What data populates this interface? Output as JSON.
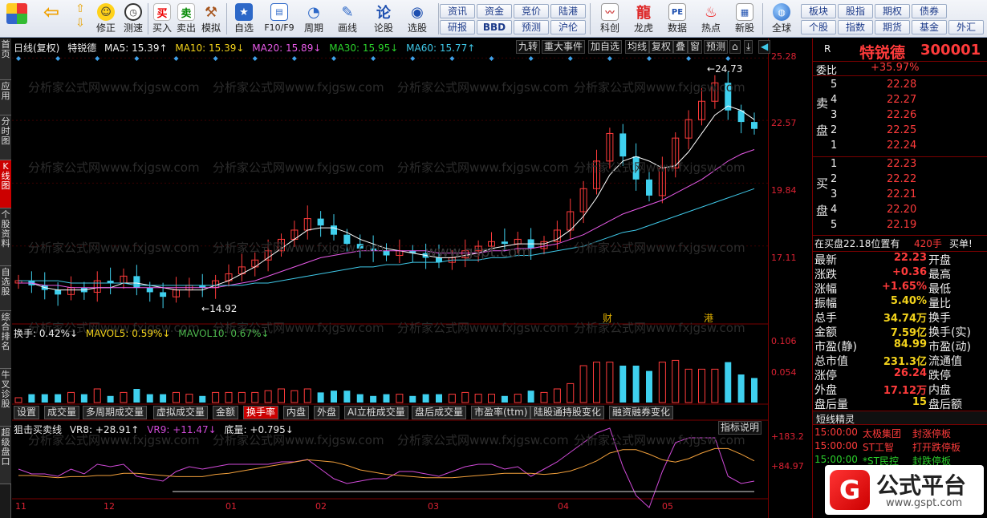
{
  "toolbar": {
    "buttons": [
      {
        "label": "",
        "icon": "apps-grid-icon"
      },
      {
        "label": "",
        "icon": "back-arrow-icon"
      },
      {
        "label": "",
        "icon": "up-down-arrows-icon"
      },
      {
        "label": "修正",
        "icon": "smile-icon"
      },
      {
        "label": "测速",
        "icon": "clock-icon"
      },
      {
        "label": "买入",
        "icon": "buy-icon",
        "glyph": "买"
      },
      {
        "label": "卖出",
        "icon": "sell-icon",
        "glyph": "卖"
      },
      {
        "label": "模拟",
        "icon": "hammer-icon"
      },
      {
        "label": "自选",
        "icon": "star-icon"
      },
      {
        "label": "F10/F9",
        "icon": "f10-icon"
      },
      {
        "label": "周期",
        "icon": "cycle-icon"
      },
      {
        "label": "画线",
        "icon": "pencil-icon"
      },
      {
        "label": "论股",
        "icon": "talk-icon",
        "glyph": "论"
      },
      {
        "label": "选股",
        "icon": "select-stock-icon"
      },
      {
        "label": "科创",
        "icon": "kechuang-icon"
      },
      {
        "label": "龙虎",
        "icon": "dragon-tiger-icon"
      },
      {
        "label": "数据",
        "icon": "pe-data-icon",
        "glyph": "PE"
      },
      {
        "label": "热点",
        "icon": "hot-flame-icon"
      },
      {
        "label": "新股",
        "icon": "new-stock-icon"
      },
      {
        "label": "全球",
        "icon": "globe-icon"
      }
    ],
    "grid1": [
      "资讯",
      "资金",
      "竞价",
      "陆港",
      "研报",
      "BBD",
      "预测",
      "沪伦"
    ],
    "grid2": [
      "板块",
      "股指",
      "期权",
      "债券",
      "个股",
      "指数",
      "期货",
      "基金",
      "外汇"
    ]
  },
  "lefttabs": [
    "首页",
    "应用",
    "分时图",
    "K线图",
    "个股资料",
    "自选股",
    "综合排名",
    "牛叉诊股",
    "超级盘口"
  ],
  "chart": {
    "header": {
      "period": "日线(复权)",
      "name": "特锐德",
      "ma5": "MA5: 15.39↑",
      "ma10": "MA10: 15.39↓",
      "ma20": "MA20: 15.89↓",
      "ma30": "MA30: 15.95↓",
      "ma60": "MA60: 15.77↑"
    },
    "buttons": [
      "九转",
      "重大事件",
      "加自选",
      "均线",
      "复权",
      "叠",
      "窗",
      "预测"
    ],
    "watermark": "分析家公式网www.fxjgsw.com",
    "site_watermark": "www.gspt.com",
    "price_ticks": [
      "25.28",
      "22.57",
      "19.84",
      "17.11"
    ],
    "high_label": "24.73",
    "low_label": "14.92",
    "event_markers": [
      "财",
      "港"
    ],
    "vol_header": {
      "hs": "换手: 0.42%↓",
      "mavol5": "MAVOL5: 0.59%↓",
      "mavol10": "MAVOL10: 0.67%↓"
    },
    "vol_ticks": [
      "0.106",
      "0.054"
    ],
    "subtabs": [
      "设置",
      "成交量",
      "多周期成交量",
      "虚拟成交量",
      "金额",
      "换手率",
      "内盘",
      "外盘",
      "AI立桩成交量",
      "盘后成交量",
      "市盈率(ttm)",
      "陆股通持股变化",
      "融资融券变化"
    ],
    "active_subtab": "换手率",
    "ind_header": {
      "name": "狙击买卖线",
      "vr8": "VR8: +28.91↑",
      "vr9": "VR9: +11.47↓",
      "floor": "底量: +0.795↓"
    },
    "ind_button": "指标说明",
    "ind_ticks": [
      "+183.2",
      "+84.97"
    ],
    "xlabels": [
      "11",
      "12",
      "01",
      "02",
      "03",
      "04",
      "05"
    ]
  },
  "chart_data": {
    "type": "line",
    "title": "特锐德 日线(复权)",
    "ylim": [
      14.0,
      25.5
    ],
    "x": [
      "11",
      "12",
      "01",
      "02",
      "03",
      "04",
      "05"
    ],
    "series": [
      {
        "name": "Close",
        "values": [
          15.6,
          15.4,
          15.2,
          15.0,
          15.3,
          15.1,
          15.6,
          15.5,
          15.8,
          15.3,
          15.1,
          14.9,
          15.2,
          15.4,
          15.3,
          15.6,
          15.9,
          16.2,
          16.5,
          16.9,
          17.4,
          17.8,
          18.3,
          18.0,
          17.6,
          17.2,
          17.0,
          16.9,
          16.7,
          16.9,
          16.8,
          16.6,
          16.4,
          16.6,
          16.9,
          17.1,
          17.3,
          17.2,
          17.4,
          17.0,
          17.3,
          17.8,
          18.6,
          19.6,
          20.8,
          22.0,
          21.0,
          20.0,
          19.3,
          20.5,
          21.8,
          22.6,
          23.4,
          24.2,
          23.0,
          22.5,
          22.2
        ]
      },
      {
        "name": "MA5",
        "values": [
          15.5,
          15.5,
          15.3,
          15.2,
          15.2,
          15.2,
          15.3,
          15.3,
          15.5,
          15.5,
          15.4,
          15.3,
          15.2,
          15.2,
          15.2,
          15.4,
          15.6,
          15.9,
          16.2,
          16.6,
          17.0,
          17.4,
          17.8,
          17.9,
          17.9,
          17.7,
          17.4,
          17.2,
          17.0,
          16.9,
          16.8,
          16.7,
          16.6,
          16.6,
          16.7,
          16.8,
          17.0,
          17.1,
          17.2,
          17.2,
          17.2,
          17.4,
          17.8,
          18.4,
          19.2,
          20.2,
          20.8,
          21.0,
          20.8,
          20.5,
          20.6,
          21.2,
          22.0,
          22.8,
          23.2,
          23.0,
          22.6
        ]
      },
      {
        "name": "MA20",
        "values": [
          15.5,
          15.5,
          15.4,
          15.4,
          15.3,
          15.3,
          15.3,
          15.3,
          15.3,
          15.3,
          15.3,
          15.3,
          15.3,
          15.3,
          15.3,
          15.3,
          15.4,
          15.5,
          15.6,
          15.8,
          16.0,
          16.2,
          16.4,
          16.6,
          16.7,
          16.8,
          16.9,
          16.9,
          16.9,
          16.9,
          16.9,
          16.9,
          16.8,
          16.8,
          16.8,
          16.8,
          16.9,
          16.9,
          17.0,
          17.0,
          17.1,
          17.2,
          17.4,
          17.6,
          17.9,
          18.2,
          18.5,
          18.7,
          18.9,
          19.1,
          19.4,
          19.7,
          20.0,
          20.4,
          20.8,
          21.1,
          21.3
        ]
      },
      {
        "name": "MA60",
        "values": [
          15.6,
          15.6,
          15.6,
          15.6,
          15.5,
          15.5,
          15.5,
          15.5,
          15.5,
          15.4,
          15.4,
          15.4,
          15.4,
          15.4,
          15.4,
          15.4,
          15.4,
          15.4,
          15.5,
          15.5,
          15.6,
          15.7,
          15.8,
          15.9,
          16.0,
          16.1,
          16.2,
          16.2,
          16.3,
          16.3,
          16.4,
          16.4,
          16.4,
          16.5,
          16.5,
          16.5,
          16.6,
          16.6,
          16.7,
          16.7,
          16.8,
          16.9,
          17.0,
          17.1,
          17.3,
          17.5,
          17.7,
          17.8,
          18.0,
          18.2,
          18.4,
          18.6,
          18.8,
          19.0,
          19.2,
          19.4,
          19.6
        ]
      }
    ]
  },
  "right": {
    "r": "R",
    "stock_name": "特锐德",
    "stock_code": "300001",
    "weibi_label": "委比",
    "weibi_value": "+35.97%",
    "sell_label": [
      "卖",
      "盘"
    ],
    "buy_label": [
      "买",
      "盘"
    ],
    "sell": [
      {
        "lv": "5",
        "price": "22.28"
      },
      {
        "lv": "4",
        "price": "22.27"
      },
      {
        "lv": "3",
        "price": "22.26"
      },
      {
        "lv": "2",
        "price": "22.25"
      },
      {
        "lv": "1",
        "price": "22.24"
      }
    ],
    "buy": [
      {
        "lv": "1",
        "price": "22.23"
      },
      {
        "lv": "2",
        "price": "22.22"
      },
      {
        "lv": "3",
        "price": "22.21"
      },
      {
        "lv": "4",
        "price": "22.20"
      },
      {
        "lv": "5",
        "price": "22.19"
      }
    ],
    "notice": {
      "text": "在买盘22.18位置有",
      "qty": "420手",
      "act": "买单!"
    },
    "stats": [
      {
        "k1": "最新",
        "v1": "22.23",
        "c1": "red",
        "k2": "开盘"
      },
      {
        "k1": "涨跌",
        "v1": "+0.36",
        "c1": "red",
        "k2": "最高"
      },
      {
        "k1": "涨幅",
        "v1": "+1.65%",
        "c1": "red",
        "k2": "最低"
      },
      {
        "k1": "振幅",
        "v1": "5.40%",
        "c1": "yel",
        "k2": "量比"
      },
      {
        "k1": "总手",
        "v1": "34.74万",
        "c1": "yel",
        "k2": "换手"
      },
      {
        "k1": "金额",
        "v1": "7.59亿",
        "c1": "yel",
        "k2": "换手(实)"
      },
      {
        "k1": "市盈(静)",
        "v1": "84.99",
        "c1": "yel",
        "k2": "市盈(动)"
      },
      {
        "k1": "总市值",
        "v1": "231.3亿",
        "c1": "yel",
        "k2": "流通值"
      },
      {
        "k1": "涨停",
        "v1": "26.24",
        "c1": "red",
        "k2": "跌停"
      },
      {
        "k1": "外盘",
        "v1": "17.12万",
        "c1": "red",
        "k2": "内盘"
      },
      {
        "k1": "盘后量",
        "v1": "15",
        "c1": "yel",
        "k2": "盘后额"
      }
    ],
    "short_title": "短线精灵",
    "short": [
      {
        "t": "15:00:00",
        "n": "太极集团",
        "e": "封涨停板",
        "c": "red"
      },
      {
        "t": "15:00:00",
        "n": "ST工智",
        "e": "打开跌停板",
        "c": "red"
      },
      {
        "t": "15:00:00",
        "n": "*ST民控",
        "e": "封跌停板",
        "c": "grn"
      }
    ],
    "logo_text": "公式平台",
    "logo_url": "www.gspt.com"
  },
  "colors": {
    "up": "#ff3b3b",
    "down": "#3fd0ee",
    "bg": "#000000",
    "grid": "#7a0000"
  }
}
